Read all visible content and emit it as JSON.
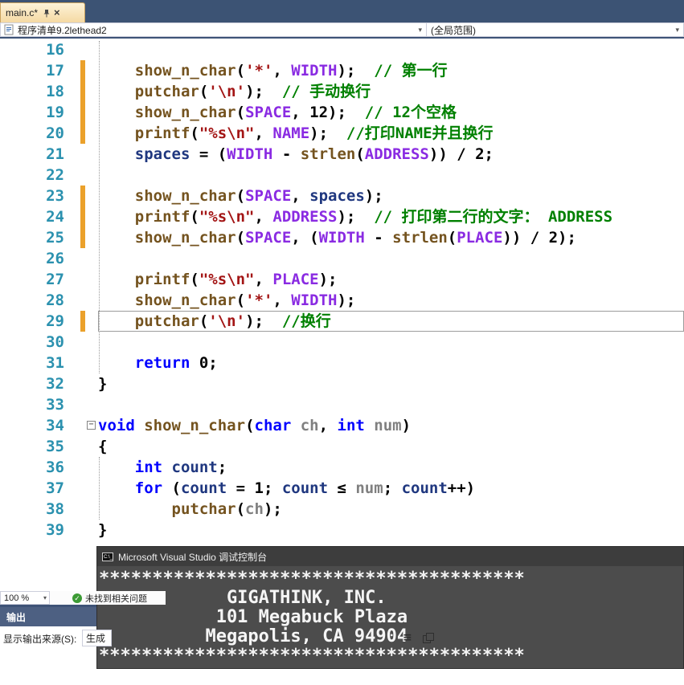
{
  "tab": {
    "title": "main.c*"
  },
  "navbar": {
    "document": "程序清单9.2lethead2",
    "scope": "(全局范围)"
  },
  "editor": {
    "changed_lines": [
      17,
      18,
      19,
      20,
      23,
      24,
      25,
      29
    ],
    "boxed_line": 29,
    "collapse_line": 34,
    "lines": [
      {
        "num": 16,
        "seg": []
      },
      {
        "num": 17,
        "seg": [
          [
            "t",
            "    "
          ],
          [
            "f",
            "show_n_char"
          ],
          [
            "t",
            "("
          ],
          [
            "s",
            "'*'"
          ],
          [
            "t",
            ", "
          ],
          [
            "m",
            "WIDTH"
          ],
          [
            "t",
            ");  "
          ],
          [
            "c",
            "// 第一行"
          ]
        ]
      },
      {
        "num": 18,
        "seg": [
          [
            "t",
            "    "
          ],
          [
            "f",
            "putchar"
          ],
          [
            "t",
            "("
          ],
          [
            "s",
            "'\\n'"
          ],
          [
            "t",
            ");  "
          ],
          [
            "c",
            "// 手动换行"
          ]
        ]
      },
      {
        "num": 19,
        "seg": [
          [
            "t",
            "    "
          ],
          [
            "f",
            "show_n_char"
          ],
          [
            "t",
            "("
          ],
          [
            "m",
            "SPACE"
          ],
          [
            "t",
            ", 12);  "
          ],
          [
            "c",
            "// 12个空格"
          ]
        ]
      },
      {
        "num": 20,
        "seg": [
          [
            "t",
            "    "
          ],
          [
            "f",
            "printf"
          ],
          [
            "t",
            "("
          ],
          [
            "s",
            "\"%s\\n\""
          ],
          [
            "t",
            ", "
          ],
          [
            "m",
            "NAME"
          ],
          [
            "t",
            ");  "
          ],
          [
            "c",
            "//打印NAME并且换行"
          ]
        ]
      },
      {
        "num": 21,
        "seg": [
          [
            "t",
            "    "
          ],
          [
            "v",
            "spaces"
          ],
          [
            "t",
            " = ("
          ],
          [
            "m",
            "WIDTH"
          ],
          [
            "t",
            " - "
          ],
          [
            "f",
            "strlen"
          ],
          [
            "t",
            "("
          ],
          [
            "m",
            "ADDRESS"
          ],
          [
            "t",
            ")) / 2;"
          ]
        ]
      },
      {
        "num": 22,
        "seg": []
      },
      {
        "num": 23,
        "seg": [
          [
            "t",
            "    "
          ],
          [
            "f",
            "show_n_char"
          ],
          [
            "t",
            "("
          ],
          [
            "m",
            "SPACE"
          ],
          [
            "t",
            ", "
          ],
          [
            "v",
            "spaces"
          ],
          [
            "t",
            ");"
          ]
        ]
      },
      {
        "num": 24,
        "seg": [
          [
            "t",
            "    "
          ],
          [
            "f",
            "printf"
          ],
          [
            "t",
            "("
          ],
          [
            "s",
            "\"%s\\n\""
          ],
          [
            "t",
            ", "
          ],
          [
            "m",
            "ADDRESS"
          ],
          [
            "t",
            ");  "
          ],
          [
            "c",
            "// 打印第二行的文字： ADDRESS"
          ]
        ]
      },
      {
        "num": 25,
        "seg": [
          [
            "t",
            "    "
          ],
          [
            "f",
            "show_n_char"
          ],
          [
            "t",
            "("
          ],
          [
            "m",
            "SPACE"
          ],
          [
            "t",
            ", ("
          ],
          [
            "m",
            "WIDTH"
          ],
          [
            "t",
            " - "
          ],
          [
            "f",
            "strlen"
          ],
          [
            "t",
            "("
          ],
          [
            "m",
            "PLACE"
          ],
          [
            "t",
            ")) / 2);"
          ]
        ]
      },
      {
        "num": 26,
        "seg": []
      },
      {
        "num": 27,
        "seg": [
          [
            "t",
            "    "
          ],
          [
            "f",
            "printf"
          ],
          [
            "t",
            "("
          ],
          [
            "s",
            "\"%s\\n\""
          ],
          [
            "t",
            ", "
          ],
          [
            "m",
            "PLACE"
          ],
          [
            "t",
            ");"
          ]
        ]
      },
      {
        "num": 28,
        "seg": [
          [
            "t",
            "    "
          ],
          [
            "f",
            "show_n_char"
          ],
          [
            "t",
            "("
          ],
          [
            "s",
            "'*'"
          ],
          [
            "t",
            ", "
          ],
          [
            "m",
            "WIDTH"
          ],
          [
            "t",
            ");"
          ]
        ]
      },
      {
        "num": 29,
        "seg": [
          [
            "t",
            "    "
          ],
          [
            "f",
            "putchar"
          ],
          [
            "t",
            "("
          ],
          [
            "s",
            "'\\n'"
          ],
          [
            "t",
            ");  "
          ],
          [
            "c",
            "//换行"
          ]
        ]
      },
      {
        "num": 30,
        "seg": []
      },
      {
        "num": 31,
        "seg": [
          [
            "t",
            "    "
          ],
          [
            "k",
            "return"
          ],
          [
            "t",
            " 0;"
          ]
        ]
      },
      {
        "num": 32,
        "seg": [
          [
            "t",
            "}"
          ]
        ]
      },
      {
        "num": 33,
        "seg": []
      },
      {
        "num": 34,
        "seg": [
          [
            "k",
            "void"
          ],
          [
            "t",
            " "
          ],
          [
            "f",
            "show_n_char"
          ],
          [
            "t",
            "("
          ],
          [
            "k",
            "char"
          ],
          [
            "t",
            " "
          ],
          [
            "p",
            "ch"
          ],
          [
            "t",
            ", "
          ],
          [
            "k",
            "int"
          ],
          [
            "t",
            " "
          ],
          [
            "p",
            "num"
          ],
          [
            "t",
            ")"
          ]
        ]
      },
      {
        "num": 35,
        "seg": [
          [
            "t",
            "{"
          ]
        ]
      },
      {
        "num": 36,
        "seg": [
          [
            "t",
            "    "
          ],
          [
            "k",
            "int"
          ],
          [
            "t",
            " "
          ],
          [
            "v",
            "count"
          ],
          [
            "t",
            ";"
          ]
        ]
      },
      {
        "num": 37,
        "seg": [
          [
            "t",
            "    "
          ],
          [
            "k",
            "for"
          ],
          [
            "t",
            " ("
          ],
          [
            "v",
            "count"
          ],
          [
            "t",
            " = 1; "
          ],
          [
            "v",
            "count"
          ],
          [
            "t",
            " ≤ "
          ],
          [
            "p",
            "num"
          ],
          [
            "t",
            "; "
          ],
          [
            "v",
            "count"
          ],
          [
            "t",
            "++)"
          ]
        ]
      },
      {
        "num": 38,
        "seg": [
          [
            "t",
            "        "
          ],
          [
            "f",
            "putchar"
          ],
          [
            "t",
            "("
          ],
          [
            "p",
            "ch"
          ],
          [
            "t",
            ");"
          ]
        ]
      },
      {
        "num": 39,
        "seg": [
          [
            "t",
            "}"
          ]
        ]
      }
    ]
  },
  "statusbar": {
    "zoom": "100 %",
    "health": "未找到相关问题"
  },
  "output": {
    "title": "输出",
    "source_label": "显示输出来源(S):",
    "source_value": "生成"
  },
  "console": {
    "title": "Microsoft Visual Studio 调试控制台",
    "lines": [
      "****************************************",
      "            GIGATHINK, INC.",
      "           101 Megabuck Plaza",
      "          Megapolis, CA 94904",
      "****************************************"
    ]
  },
  "colors": {
    "keyword": "#0000ff",
    "function": "#74531f",
    "macro": "#8a2be2",
    "string": "#a31515",
    "comment": "#008000",
    "local": "#1f377f",
    "param": "#808080",
    "plain": "#000000",
    "line_number": "#2b91af",
    "change_bar": "#eba12b"
  }
}
